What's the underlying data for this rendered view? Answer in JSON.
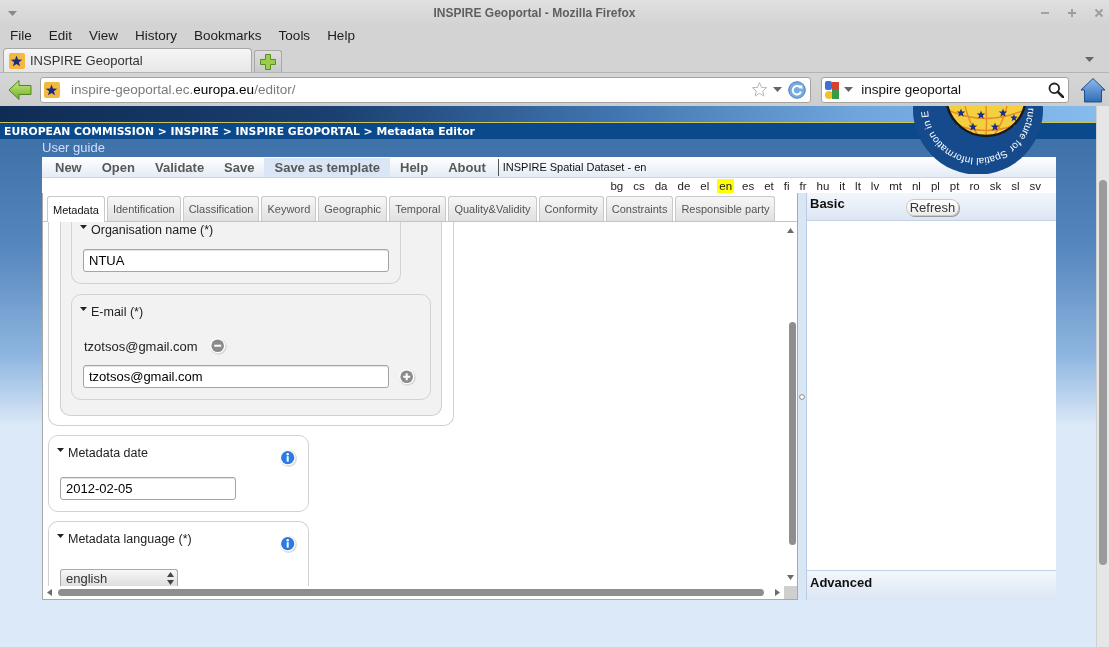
{
  "window": {
    "title": "INSPIRE Geoportal - Mozilla Firefox"
  },
  "menu": [
    "File",
    "Edit",
    "View",
    "History",
    "Bookmarks",
    "Tools",
    "Help"
  ],
  "browser_tabs": [
    {
      "title": "INSPIRE Geoportal",
      "selected": true
    }
  ],
  "address_bar": {
    "url": {
      "host_prefix": "inspire-geoportal.ec.",
      "domain": "europa.eu",
      "path": "/editor/"
    }
  },
  "search_bar": {
    "value": "inspire geoportal"
  },
  "page": {
    "logo_text": [
      "ructure for",
      "Spatial Information",
      "in E"
    ],
    "breadcrumb": "EUROPEAN COMMISSION > INSPIRE > INSPIRE GEOPORTAL > Metadata Editor",
    "user_guide_link": "User guide"
  },
  "editor": {
    "toolbar": [
      {
        "label": "New",
        "highlighted": false
      },
      {
        "label": "Open",
        "highlighted": false
      },
      {
        "label": "Validate",
        "highlighted": false
      },
      {
        "label": "Save",
        "highlighted": false
      },
      {
        "label": "Save as template",
        "highlighted": true
      },
      {
        "label": "Help",
        "highlighted": false
      },
      {
        "label": "About",
        "highlighted": false
      }
    ],
    "document_title": "INSPIRE Spatial Dataset - en",
    "languages": [
      {
        "code": "bg",
        "selected": false
      },
      {
        "code": "cs",
        "selected": false
      },
      {
        "code": "da",
        "selected": false
      },
      {
        "code": "de",
        "selected": false
      },
      {
        "code": "el",
        "selected": false
      },
      {
        "code": "en",
        "selected": true
      },
      {
        "code": "es",
        "selected": false
      },
      {
        "code": "et",
        "selected": false
      },
      {
        "code": "fi",
        "selected": false
      },
      {
        "code": "fr",
        "selected": false
      },
      {
        "code": "hu",
        "selected": false
      },
      {
        "code": "it",
        "selected": false
      },
      {
        "code": "lt",
        "selected": false
      },
      {
        "code": "lv",
        "selected": false
      },
      {
        "code": "mt",
        "selected": false
      },
      {
        "code": "nl",
        "selected": false
      },
      {
        "code": "pl",
        "selected": false
      },
      {
        "code": "pt",
        "selected": false
      },
      {
        "code": "ro",
        "selected": false
      },
      {
        "code": "sk",
        "selected": false
      },
      {
        "code": "sl",
        "selected": false
      },
      {
        "code": "sv",
        "selected": false
      }
    ],
    "tabs": [
      {
        "label": "Metadata",
        "selected": true
      },
      {
        "label": "Identification",
        "selected": false
      },
      {
        "label": "Classification",
        "selected": false
      },
      {
        "label": "Keyword",
        "selected": false
      },
      {
        "label": "Geographic",
        "selected": false
      },
      {
        "label": "Temporal",
        "selected": false
      },
      {
        "label": "Quality&Validity",
        "selected": false
      },
      {
        "label": "Conformity",
        "selected": false
      },
      {
        "label": "Constraints",
        "selected": false
      },
      {
        "label": "Responsible party",
        "selected": false
      }
    ],
    "form": [
      {
        "kind": "group",
        "children": [
          {
            "kind": "group",
            "children": [
              {
                "kind": "text",
                "label": "Organisation name (*)",
                "expanded": true,
                "info": false,
                "value": "NTUA"
              },
              {
                "kind": "multi_text",
                "label": "E-mail (*)",
                "expanded": true,
                "info": false,
                "entries": [
                  "tzotsos@gmail.com"
                ],
                "value": "tzotsos@gmail.com"
              }
            ]
          }
        ]
      },
      {
        "kind": "text",
        "label": "Metadata date",
        "expanded": true,
        "info": true,
        "value": "2012-02-05"
      },
      {
        "kind": "select",
        "label": "Metadata language (*)",
        "expanded": true,
        "info": true,
        "value": "english"
      }
    ],
    "side_panel": {
      "basic": {
        "title": "Basic",
        "button": "Refresh"
      },
      "advanced": {
        "title": "Advanced"
      }
    }
  }
}
